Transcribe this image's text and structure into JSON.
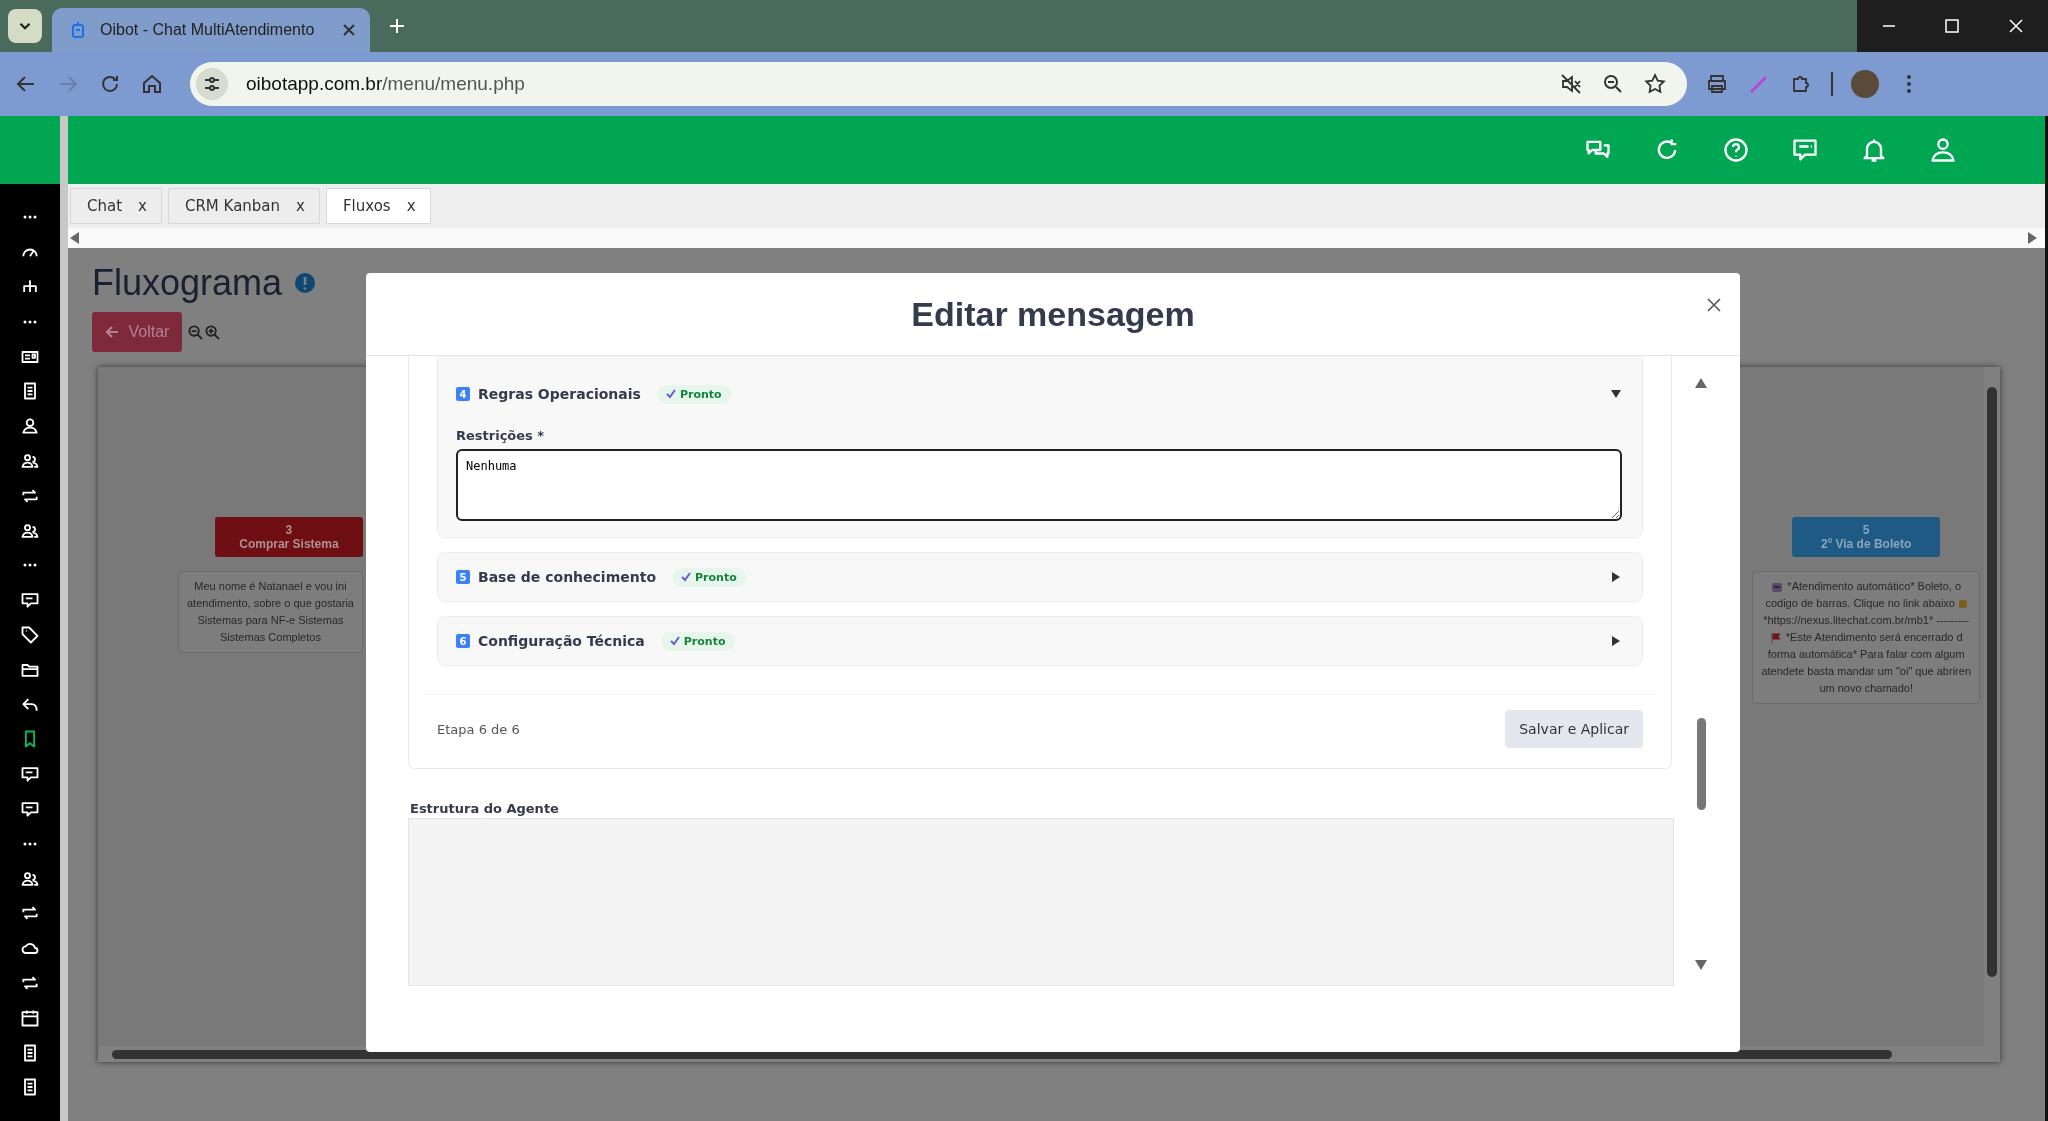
{
  "browser": {
    "tab_title": "Oibot - Chat MultiAtendimento",
    "url_host": "oibotapp.com.br",
    "url_path": "/menu/menu.php"
  },
  "sidebar": {
    "items": [
      {
        "selected": false
      },
      {
        "selected": false
      },
      {
        "selected": false
      },
      {
        "selected": false
      },
      {
        "selected": false
      },
      {
        "selected": false
      },
      {
        "selected": false
      },
      {
        "selected": false
      },
      {
        "selected": false
      },
      {
        "selected": false
      },
      {
        "selected": false
      },
      {
        "selected": false
      },
      {
        "selected": false
      },
      {
        "selected": false
      },
      {
        "selected": false
      },
      {
        "selected": true
      },
      {
        "selected": false
      },
      {
        "selected": false
      },
      {
        "selected": false
      },
      {
        "selected": false
      },
      {
        "selected": false
      },
      {
        "selected": false
      },
      {
        "selected": false
      },
      {
        "selected": false
      },
      {
        "selected": false
      },
      {
        "selected": false
      }
    ]
  },
  "tabs": [
    {
      "label": "Chat",
      "close": "x",
      "selected": false
    },
    {
      "label": "CRM Kanban",
      "close": "x",
      "selected": false
    },
    {
      "label": "Fluxos",
      "close": "x",
      "selected": true
    }
  ],
  "page": {
    "title": "Fluxograma",
    "back_button": "Voltar"
  },
  "canvas": {
    "nodes": [
      {
        "number": "3",
        "label": "Comprar Sistema",
        "color": "#6f0f14",
        "message_lines": [
          "Meu nome é Natanael e vou ini",
          "atendimento, sobre o que gostaria",
          "Sistemas para NF-e Sistemas",
          "Sistemas Completos"
        ]
      },
      {
        "number": "5",
        "label": "2º Via de Boleto",
        "color": "#1f5a85",
        "message_lines": [
          "*Atendimento automático* Boleto, o",
          "codigo de barras. Clique no link abaixo",
          "*https://nexus.litechat.com.br/mb1* ---------",
          "*Este Atendimento será encerrado d",
          "forma automática* Para falar com algum",
          "atendete basta mandar um \"oi\" que abriren",
          "um novo chamado!"
        ]
      }
    ]
  },
  "modal": {
    "title": "Editar mensagem",
    "sections": [
      {
        "number": "4",
        "title": "Regras Operacionais",
        "status": "Pronto",
        "expanded": true,
        "field": {
          "label": "Restrições *",
          "value": "Nenhuma"
        }
      },
      {
        "number": "5",
        "title": "Base de conhecimento",
        "status": "Pronto",
        "expanded": false
      },
      {
        "number": "6",
        "title": "Configuração Técnica",
        "status": "Pronto",
        "expanded": false
      }
    ],
    "step": "Etapa 6 de 6",
    "save_button": "Salvar e Aplicar",
    "structure_label": "Estrutura do Agente"
  }
}
